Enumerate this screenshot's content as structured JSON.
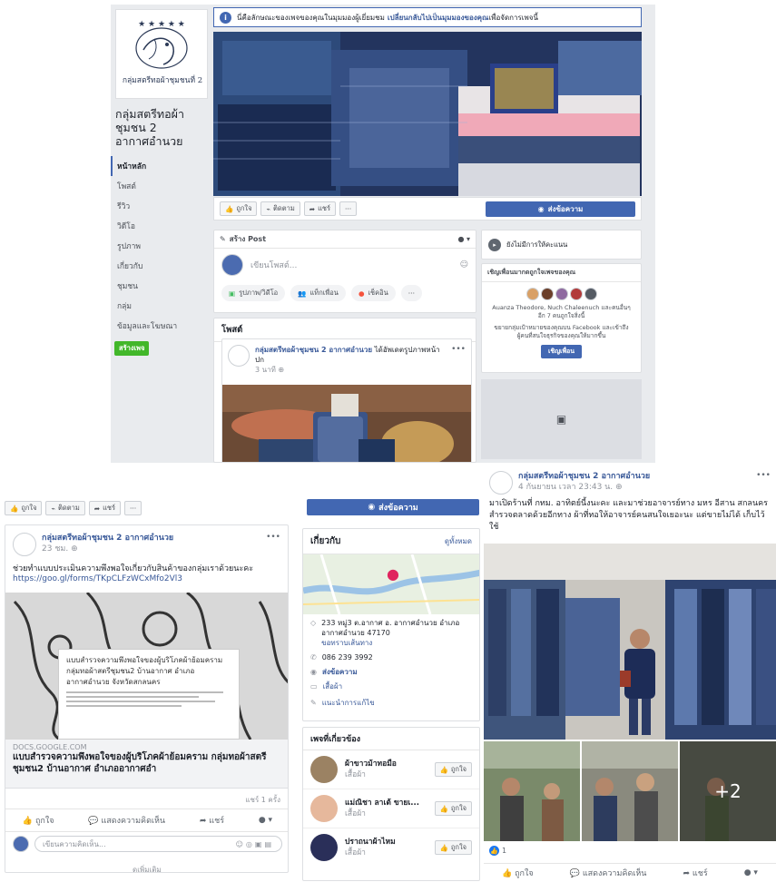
{
  "page": {
    "name": "กลุ่มสตรีทอผ้าชุมชน 2 อากาศอำนวย",
    "name_lines": [
      "กลุ่มสตรีทอผ้า",
      "ชุมชน 2",
      "อากาศอำนวย"
    ],
    "logo_text": "กลุ่มสตรีทอผ้าชุมชนที่ 2"
  },
  "notice": {
    "text": "นี่คือลักษณะของเพจของคุณในมุมมองผู้เยี่ยมชม",
    "link": "เปลี่ยนกลับไปเป็นมุมมองของคุณ",
    "suffix": "เพื่อจัดการเพจนี้"
  },
  "sidebar": {
    "items": [
      {
        "label": "หน้าหลัก",
        "active": true
      },
      {
        "label": "โพสต์"
      },
      {
        "label": "รีวิว"
      },
      {
        "label": "วิดีโอ"
      },
      {
        "label": "รูปภาพ"
      },
      {
        "label": "เกี่ยวกับ"
      },
      {
        "label": "ชุมชน"
      },
      {
        "label": "กลุ่ม"
      },
      {
        "label": "ข้อมูลและโฆษณา"
      }
    ],
    "create_page": "สร้างเพจ"
  },
  "actions": {
    "like": "ถูกใจ",
    "follow": "ติดตาม",
    "share": "แชร์",
    "more": "···",
    "message": "ส่งข้อความ"
  },
  "composer": {
    "title": "สร้าง Post",
    "placeholder": "เขียนโพสต์...",
    "photo_video": "รูปภาพ/วิดีโอ",
    "tag": "แท็กเพื่อน",
    "checkin": "เช็คอิน",
    "more": "···"
  },
  "posts_header": "โพสต์",
  "post1": {
    "author": "กลุ่มสตรีทอผ้าชุมชน 2 อากาศอำนวย",
    "action": "ได้อัพเดตรูปภาพหน้าปก",
    "time": "3 นาที"
  },
  "no_rating": "ยังไม่มีการให้คะแนน",
  "invite": {
    "title": "เชิญเพื่อนมากดถูกใจเพจของคุณ",
    "names": "Auanza Theodore, Nuch Chaleenuch และคนอื่นๆ อีก 7 คนถูกใจสิ่งนี้",
    "desc": "ขยายกลุ่มเป้าหมายของคุณบน Facebook และเข้าถึงผู้คนที่สนใจธุรกิจของคุณให้มากขึ้น",
    "button": "เชิญเพื่อน"
  },
  "post2": {
    "author": "กลุ่มสตรีทอผ้าชุมชน 2 อากาศอำนวย",
    "time": "23 ชม.",
    "text": "ช่วยทำแบบประเมินความพึงพอใจเกี่ยวกับสินค้าของกลุ่มเราด้วยนะคะ",
    "link": "https://goo.gl/forms/TKpCLFzWCxMfo2Vl3",
    "form_title": "แบบสำรวจความพึงพอใจของผู้บริโภคผ้าย้อมคราม กลุ่มทอผ้าสตรีชุมชน2 บ้านอากาศ อำเภออากาศอำนวย จังหวัดสกลนคร",
    "domain": "DOCS.GOOGLE.COM",
    "headline": "แบบสำรวจความพึงพอใจของผู้บริโภคผ้าย้อมคราม กลุ่มทอผ้าสตรีชุมชน2 บ้านอากาศ อำเภออากาศอำ",
    "shares": "แชร์ 1 ครั้ง",
    "comment": "แสดงความคิดเห็น",
    "comment_placeholder": "เขียนความคิดเห็น...",
    "see_more": "ดูเพิ่มเติม"
  },
  "about": {
    "title": "เกี่ยวกับ",
    "see_all": "ดูทั้งหมด",
    "address": "233 หมู่3 ต.อากาศ อ. อากาศอำนวย อำเภออากาศอำนวย 47170",
    "directions": "ขอทราบเส้นทาง",
    "phone": "086 239 3992",
    "send_message": "ส่งข้อความ",
    "category": "เสื้อผ้า",
    "suggest_edits": "แนะนำการแก้ไข"
  },
  "related": {
    "title": "เพจที่เกี่ยวข้อง",
    "items": [
      {
        "name": "ผ้าขาวม้าทอมือ",
        "category": "เสื้อผ้า"
      },
      {
        "name": "แม่ณิชา ลาเต้ ขายเ...",
        "category": "เสื้อผ้า"
      },
      {
        "name": "ปราถนาผ้าไหม",
        "category": "เสื้อผ้า"
      }
    ],
    "like": "ถูกใจ"
  },
  "post3": {
    "author": "กลุ่มสตรีทอผ้าชุมชน 2 อากาศอำนวย",
    "time": "4 กันยายน เวลา 23:43 น.",
    "text": "มาเปิดร้านที่ กทม. อาทิตย์นี้งนะคะ และมาช่วยอาจารย์ทาง มหร อีสาน สกลนคร สำรวจตลาดด้วยอีกทาง ผ้าที่ทอให้อาจารย์คนสนใจเยอะนะ แต่ขายไม่ได้ เก็บไว้ใช้",
    "more_photos": "+2",
    "reactions": "1",
    "comment": "แสดงความคิดเห็น"
  }
}
